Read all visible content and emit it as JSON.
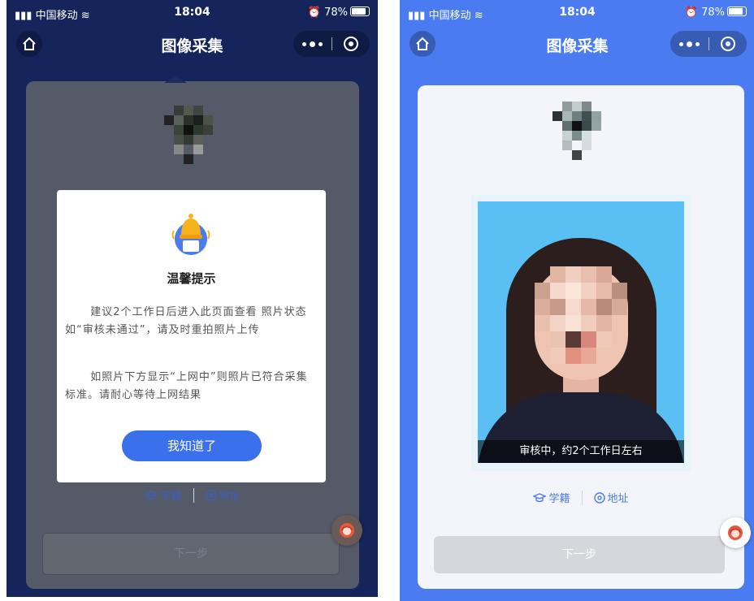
{
  "status_bar": {
    "carrier": "中国移动",
    "time": "18:04",
    "battery": "78%"
  },
  "nav": {
    "title": "图像采集"
  },
  "modal": {
    "title": "温馨提示",
    "paragraph1": "建议2个工作日后进入此页面查看 照片状态如“审核未通过”，请及时重拍照片上传",
    "paragraph2": "如照片下方显示“上网中”则照片已符合采集标准。请耐心等待上网结果",
    "confirm_label": "我知道了"
  },
  "photo": {
    "caption": "审核中，约2个工作日左右"
  },
  "info": {
    "school_label": "学籍",
    "address_label": "地址"
  },
  "next_label": "下一步",
  "colors": {
    "primary": "#4a7bf0",
    "button_disabled": "#d6d7dc",
    "modal_button": "#3b70ec",
    "photo_bg": "#5ac0f4"
  }
}
